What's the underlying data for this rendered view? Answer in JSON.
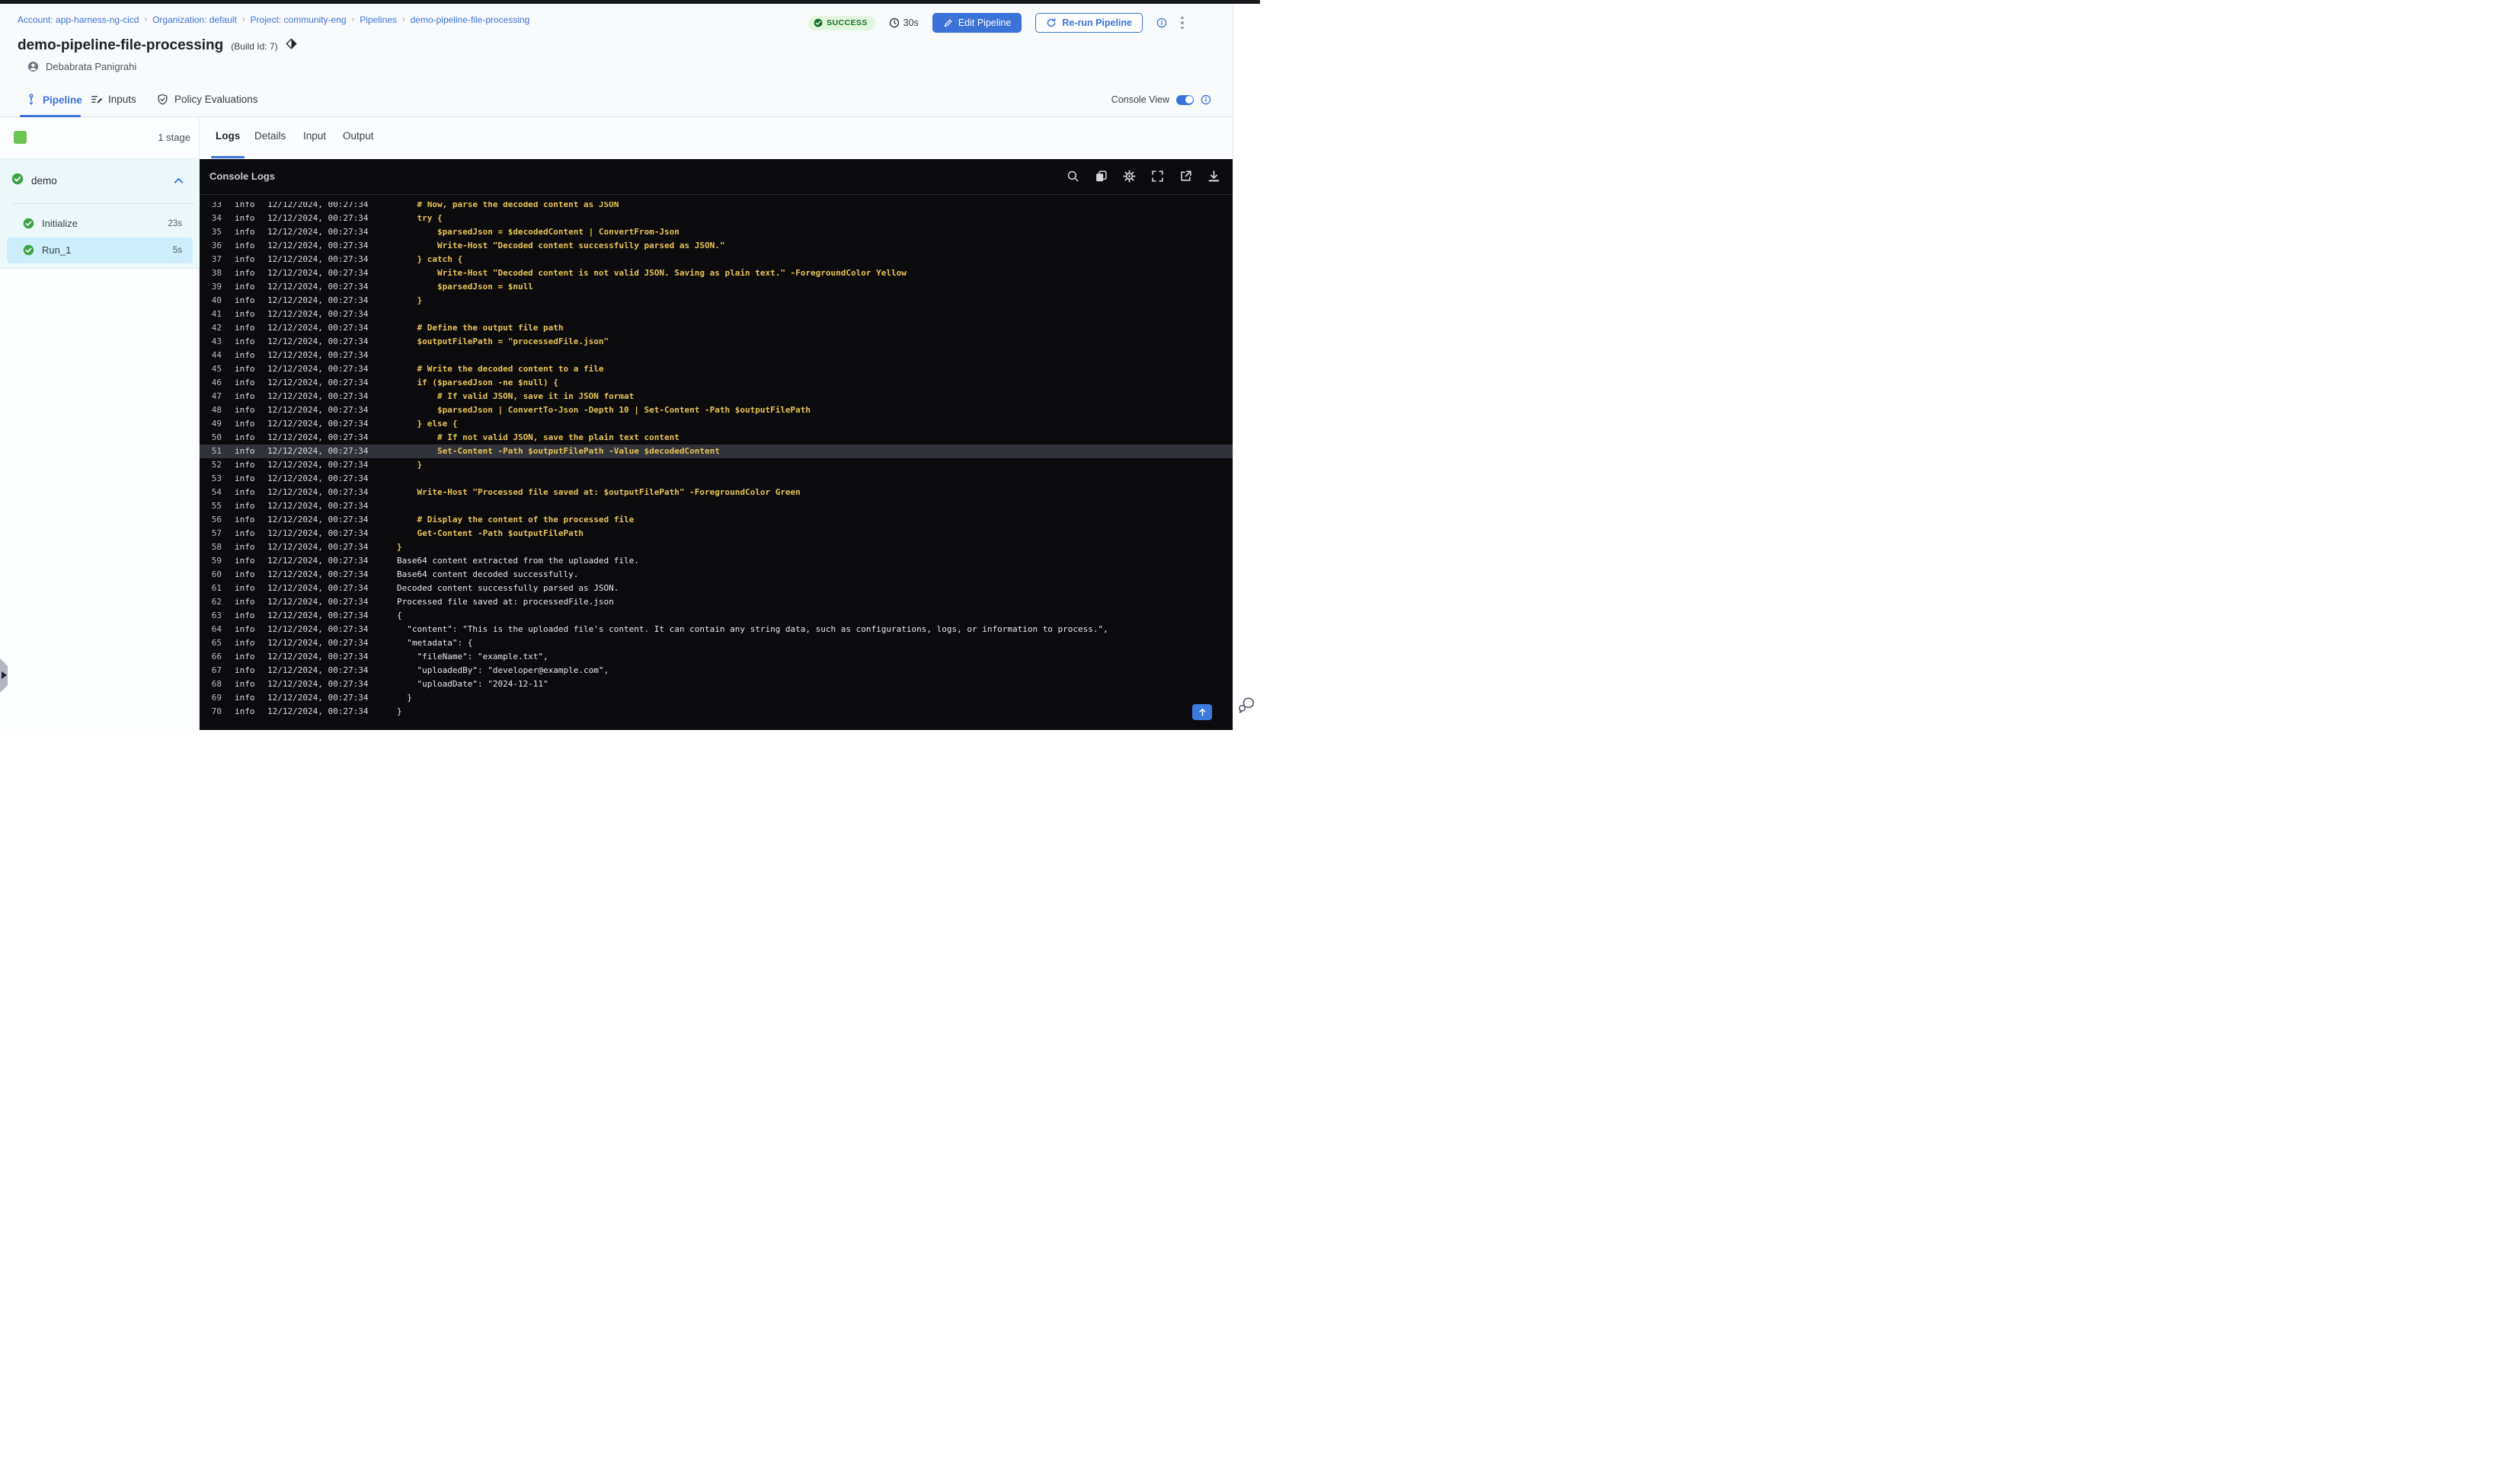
{
  "breadcrumb": {
    "items": [
      "Account: app-harness-ng-cicd",
      "Organization: default",
      "Project: community-eng",
      "Pipelines",
      "demo-pipeline-file-processing"
    ]
  },
  "run_header": {
    "status": "SUCCESS",
    "duration": "30s",
    "edit_pipeline": "Edit Pipeline",
    "rerun_pipeline": "Re-run Pipeline"
  },
  "pipeline_header": {
    "title": "demo-pipeline-file-processing",
    "build_id": "(Build Id: 7)",
    "author": "Debabrata Panigrahi"
  },
  "nav_tabs": {
    "pipeline": "Pipeline",
    "inputs": "Inputs",
    "policy_evaluations": "Policy Evaluations",
    "console_view_label": "Console View",
    "console_view_on": true
  },
  "sidebar": {
    "stage_count": "1 stage",
    "group": {
      "name": "demo",
      "status": "success"
    },
    "steps": [
      {
        "name": "Initialize",
        "duration": "23s",
        "status": "success",
        "selected": false
      },
      {
        "name": "Run_1",
        "duration": "5s",
        "status": "success",
        "selected": true
      }
    ]
  },
  "console": {
    "tabs": [
      {
        "label": "Logs",
        "active": true
      },
      {
        "label": "Details",
        "active": false
      },
      {
        "label": "Input",
        "active": false
      },
      {
        "label": "Output",
        "active": false
      }
    ],
    "title": "Console Logs",
    "toolbar_icons": [
      "search-icon",
      "copy-icon",
      "settings-icon",
      "fullscreen-icon",
      "open-in-new-icon",
      "download-icon"
    ],
    "log_level": "info",
    "timestamp": "12/12/2024, 00:27:34",
    "highlighted_line": 51,
    "lines": [
      {
        "n": 33,
        "k": "s",
        "t": "    # Now, parse the decoded content as JSON"
      },
      {
        "n": 34,
        "k": "s",
        "t": "    try {"
      },
      {
        "n": 35,
        "k": "s",
        "t": "        $parsedJson = $decodedContent | ConvertFrom-Json"
      },
      {
        "n": 36,
        "k": "s",
        "t": "        Write-Host \"Decoded content successfully parsed as JSON.\""
      },
      {
        "n": 37,
        "k": "s",
        "t": "    } catch {"
      },
      {
        "n": 38,
        "k": "s",
        "t": "        Write-Host \"Decoded content is not valid JSON. Saving as plain text.\" -ForegroundColor Yellow"
      },
      {
        "n": 39,
        "k": "s",
        "t": "        $parsedJson = $null"
      },
      {
        "n": 40,
        "k": "s",
        "t": "    }"
      },
      {
        "n": 41,
        "k": "s",
        "t": ""
      },
      {
        "n": 42,
        "k": "s",
        "t": "    # Define the output file path"
      },
      {
        "n": 43,
        "k": "s",
        "t": "    $outputFilePath = \"processedFile.json\""
      },
      {
        "n": 44,
        "k": "s",
        "t": ""
      },
      {
        "n": 45,
        "k": "s",
        "t": "    # Write the decoded content to a file"
      },
      {
        "n": 46,
        "k": "s",
        "t": "    if ($parsedJson -ne $null) {"
      },
      {
        "n": 47,
        "k": "s",
        "t": "        # If valid JSON, save it in JSON format"
      },
      {
        "n": 48,
        "k": "s",
        "t": "        $parsedJson | ConvertTo-Json -Depth 10 | Set-Content -Path $outputFilePath"
      },
      {
        "n": 49,
        "k": "s",
        "t": "    } else {"
      },
      {
        "n": 50,
        "k": "s",
        "t": "        # If not valid JSON, save the plain text content"
      },
      {
        "n": 51,
        "k": "s",
        "t": "        Set-Content -Path $outputFilePath -Value $decodedContent"
      },
      {
        "n": 52,
        "k": "s",
        "t": "    }"
      },
      {
        "n": 53,
        "k": "s",
        "t": ""
      },
      {
        "n": 54,
        "k": "s",
        "t": "    Write-Host \"Processed file saved at: $outputFilePath\" -ForegroundColor Green"
      },
      {
        "n": 55,
        "k": "s",
        "t": ""
      },
      {
        "n": 56,
        "k": "s",
        "t": "    # Display the content of the processed file"
      },
      {
        "n": 57,
        "k": "s",
        "t": "    Get-Content -Path $outputFilePath"
      },
      {
        "n": 58,
        "k": "s",
        "t": "}"
      },
      {
        "n": 59,
        "k": "o",
        "t": "Base64 content extracted from the uploaded file."
      },
      {
        "n": 60,
        "k": "o",
        "t": "Base64 content decoded successfully."
      },
      {
        "n": 61,
        "k": "o",
        "t": "Decoded content successfully parsed as JSON."
      },
      {
        "n": 62,
        "k": "o",
        "t": "Processed file saved at: processedFile.json"
      },
      {
        "n": 63,
        "k": "o",
        "t": "{"
      },
      {
        "n": 64,
        "k": "o",
        "t": "  \"content\": \"This is the uploaded file's content. It can contain any string data, such as configurations, logs, or information to process.\","
      },
      {
        "n": 65,
        "k": "o",
        "t": "  \"metadata\": {"
      },
      {
        "n": 66,
        "k": "o",
        "t": "    \"fileName\": \"example.txt\","
      },
      {
        "n": 67,
        "k": "o",
        "t": "    \"uploadedBy\": \"developer@example.com\","
      },
      {
        "n": 68,
        "k": "o",
        "t": "    \"uploadDate\": \"2024-12-11\""
      },
      {
        "n": 69,
        "k": "o",
        "t": "  }"
      },
      {
        "n": 70,
        "k": "o",
        "t": "}"
      }
    ]
  },
  "colors": {
    "primary_blue": "#3b73d8",
    "success_badge_bg": "#e2f6de",
    "success_badge_text": "#17722c",
    "step_check_green": "#3fa345",
    "stage_square_green": "#6cc455",
    "console_bg": "#0b0b0d",
    "log_script_yellow": "#e6c358",
    "log_output_white": "#e9eaef",
    "highlight_row_bg": "#303339",
    "selected_step_bg": "#cdeffb"
  }
}
